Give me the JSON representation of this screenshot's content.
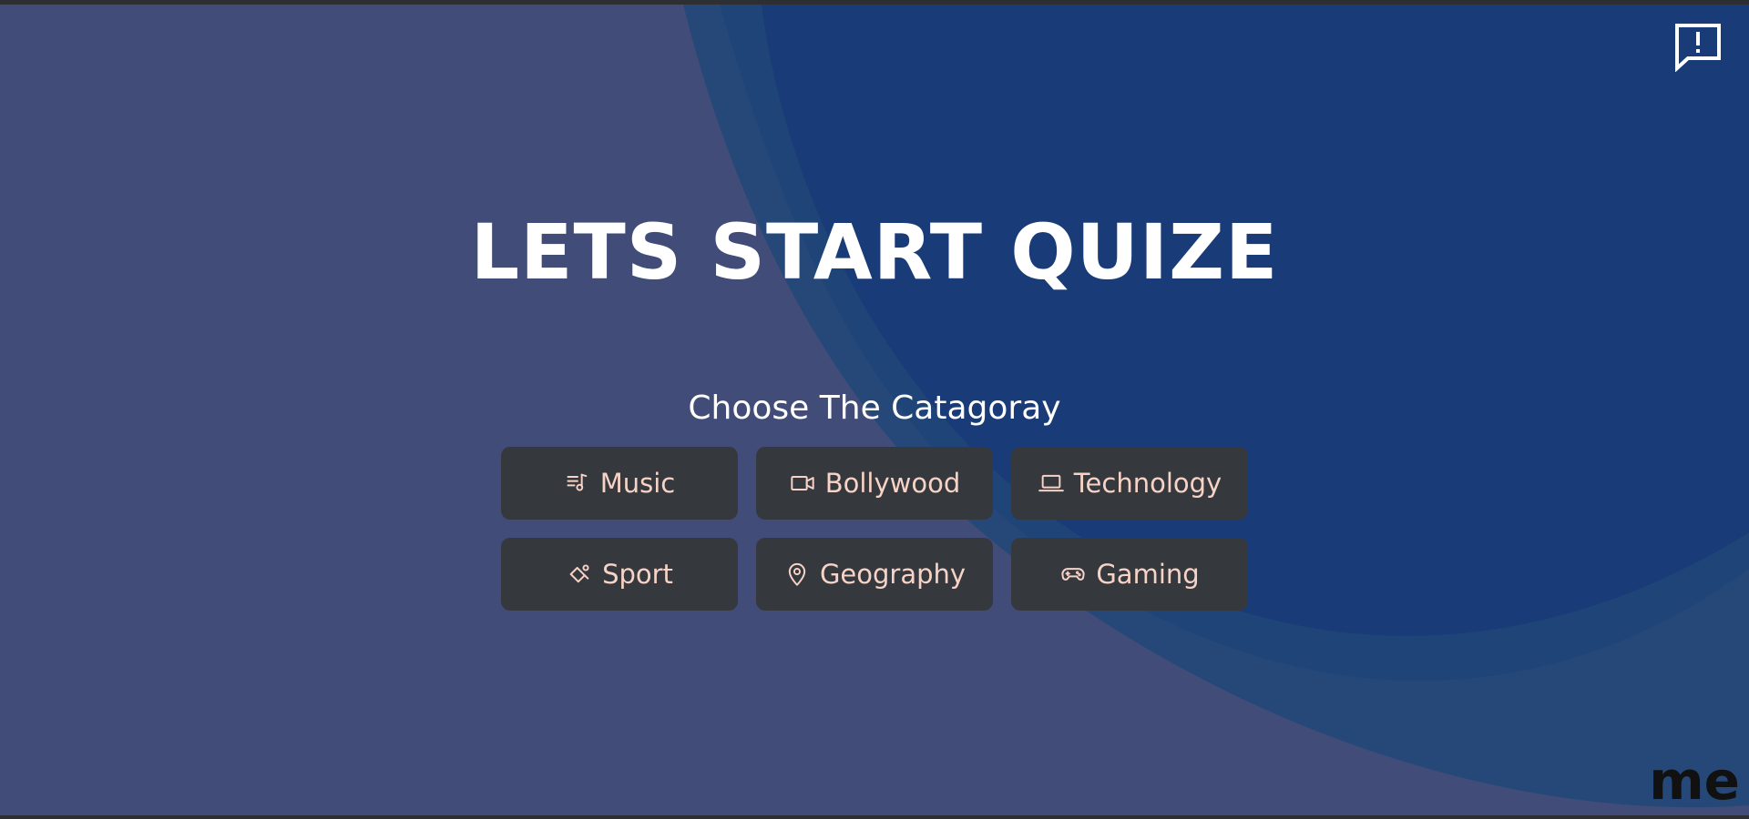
{
  "hero": {
    "title": "LETS START QUIZE",
    "subtitle": "Choose The Catagoray"
  },
  "categories": [
    {
      "label": "Music",
      "icon": "music-list-icon"
    },
    {
      "label": "Bollywood",
      "icon": "video-camera-icon"
    },
    {
      "label": "Technology",
      "icon": "laptop-icon"
    },
    {
      "label": "Sport",
      "icon": "bat-ball-icon"
    },
    {
      "label": "Geography",
      "icon": "map-pin-icon"
    },
    {
      "label": "Gaming",
      "icon": "gamepad-icon"
    }
  ],
  "feedback": {
    "icon": "feedback-icon"
  },
  "brand": {
    "text": "me"
  },
  "colors": {
    "background": "#414d78",
    "wave_dark": "#193b78",
    "wave_mid": "#1e4478",
    "button_bg": "#35383d",
    "button_text": "#f6d3c6",
    "title_text": "#ffffff"
  }
}
